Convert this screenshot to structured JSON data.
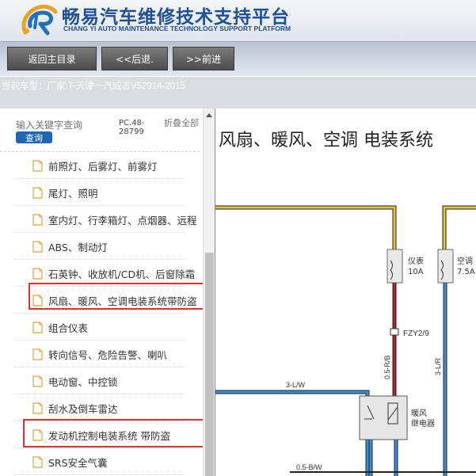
{
  "header": {
    "title": "畅易汽车维修技术支持平台",
    "subtitle": "CHANG YI AUTO MAINTENANCE TECHNOLOGY SUPPORT PLATFORM"
  },
  "nav": {
    "home": "返回主目录",
    "back": "<<后退.",
    "forward": ">>前进"
  },
  "vehicle": {
    "label": "当前车型：",
    "value": "厂家:T-天津一汽威志V52014-2015"
  },
  "sidebar": {
    "search_placeholder": "输入关键字查询",
    "search_button": "查询",
    "pc_code": "PC.48-28799",
    "collapse_all": "折叠全部",
    "items": [
      {
        "label": "前照灯、后雾灯、前雾灯"
      },
      {
        "label": "尾灯、照明"
      },
      {
        "label": "室内灯、行李箱灯、点烟器、远程"
      },
      {
        "label": "ABS、制动灯"
      },
      {
        "label": "石英钟、收放机/CD机、后窗除霜"
      },
      {
        "label": "风扇、暖风、空调电装系统带防盗"
      },
      {
        "label": "组合仪表"
      },
      {
        "label": "转向信号、危险告警、喇叭"
      },
      {
        "label": "电动窗、中控锁"
      },
      {
        "label": "刮水及倒车雷达"
      },
      {
        "label": "发动机控制电装系统 带防盗"
      },
      {
        "label": "SRS安全气囊"
      }
    ],
    "highlighted": [
      5,
      10
    ]
  },
  "content": {
    "title": "风扇、暖风、空调 电装系统",
    "fuse1": {
      "name": "仪表",
      "rating": "10A"
    },
    "fuse2": {
      "name": "空调",
      "rating": "7.5A"
    },
    "connector": "FZY2/9",
    "wire1": "0.5-R/B",
    "wire2": "3-L/R",
    "wire3": "3-L/W",
    "wire4": "0.5-B/W",
    "relay": {
      "name1": "暖风",
      "name2": "继电器"
    }
  },
  "colors": {
    "brand": "#1f4f96",
    "highlight": "#e03030",
    "wire_yellow": "#e8c23a",
    "wire_red": "#b0242c",
    "wire_blue": "#3a8fd6"
  }
}
